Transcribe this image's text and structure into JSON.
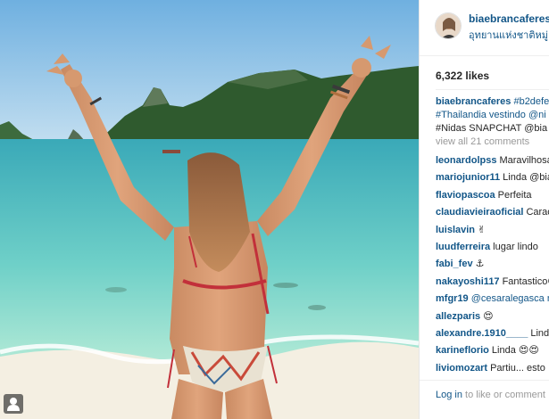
{
  "post": {
    "username": "biaebrancaferes",
    "location": "อุทยานแห่งชาติหมู่",
    "likes": "6,322 likes",
    "caption_lines": [
      {
        "username": "biaebrancaferes",
        "text": "#b2defe"
      },
      {
        "username": "",
        "text": "#Thailandia vestindo @ni"
      },
      {
        "username": "",
        "text": "#Nidas SNAPCHAT @bia"
      }
    ],
    "view_all_comments": "view all 21 comments",
    "comments": [
      {
        "user": "leonardolpss",
        "text": "Maravilhosa"
      },
      {
        "user": "mariojunior11",
        "text": "Linda @bia"
      },
      {
        "user": "flaviopascoa",
        "text": "Perfeita"
      },
      {
        "user": "claudiavieiraoficial",
        "text": "Caracas"
      },
      {
        "user": "luislavin",
        "text": "✌"
      },
      {
        "user": "luudferreira",
        "text": "lugar lindo"
      },
      {
        "user": "fabi_fev",
        "text": "⚓"
      },
      {
        "user": "nakayoshi117",
        "text": "Fantastico😍"
      },
      {
        "user": "mfgr19",
        "text": "@cesaralegasca n"
      },
      {
        "user": "allezparis",
        "text": "😍"
      },
      {
        "user": "alexandre.1910____",
        "text": "Linda"
      },
      {
        "user": "karineflorio",
        "text": "Linda 😍😍"
      },
      {
        "user": "liviomozart",
        "text": "Partiu... esto"
      }
    ],
    "footer": {
      "login_link": "Log in",
      "rest": " to like or comment"
    }
  },
  "colors": {
    "link_blue": "#125688",
    "sky": "#8fc3e6",
    "sea": "#5fc6c8",
    "sand": "#f4efe2"
  },
  "icons": {
    "photo_user_tag": "person-silhouette-icon"
  }
}
